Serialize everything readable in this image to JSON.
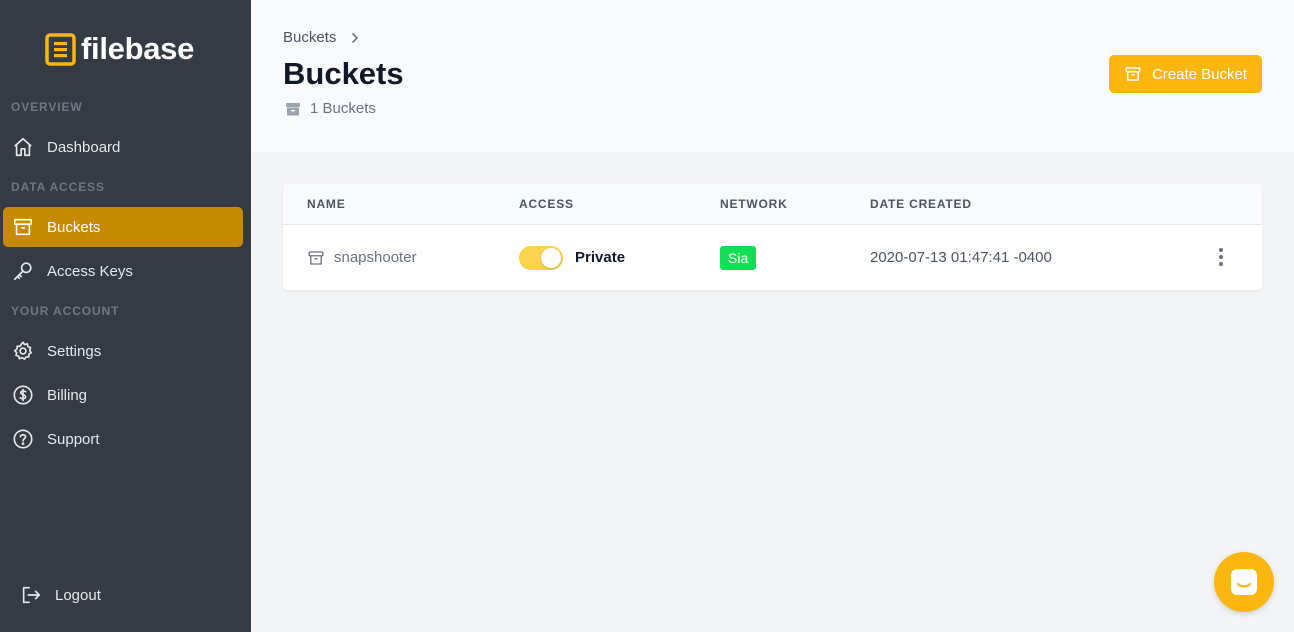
{
  "brand": {
    "name": "filebase",
    "accent": "#fbb610",
    "sidebar_bg": "#353b45",
    "active_bg": "#c88a00"
  },
  "sidebar": {
    "sections": {
      "overview": "OVERVIEW",
      "data_access": "DATA ACCESS",
      "your_account": "YOUR ACCOUNT"
    },
    "items": {
      "dashboard": {
        "label": "Dashboard",
        "icon": "home-icon"
      },
      "buckets": {
        "label": "Buckets",
        "icon": "archive-icon",
        "active": true
      },
      "access_keys": {
        "label": "Access Keys",
        "icon": "key-icon"
      },
      "settings": {
        "label": "Settings",
        "icon": "gear-icon"
      },
      "billing": {
        "label": "Billing",
        "icon": "dollar-icon"
      },
      "support": {
        "label": "Support",
        "icon": "question-icon"
      }
    },
    "logout": {
      "label": "Logout",
      "icon": "logout-icon"
    }
  },
  "header": {
    "breadcrumb": "Buckets",
    "title": "Buckets",
    "count": "1 Buckets",
    "create_button": "Create Bucket"
  },
  "table": {
    "columns": {
      "name": "NAME",
      "access": "ACCESS",
      "network": "NETWORK",
      "date": "DATE CREATED"
    },
    "rows": [
      {
        "name": "snapshooter",
        "access": "Private",
        "access_on": true,
        "network": "Sia",
        "network_color": "#11dd55",
        "date_created": "2020-07-13 01:47:41 -0400"
      }
    ]
  },
  "chat": {
    "icon": "chat-icon"
  }
}
